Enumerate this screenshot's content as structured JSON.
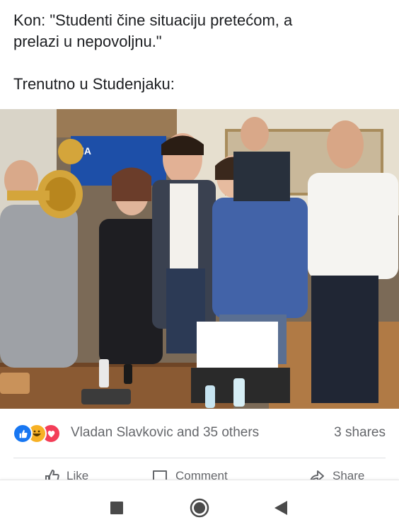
{
  "post": {
    "line1": "Kon: \"Studenti čine situaciju pretećom, a",
    "line2": "prelazi u nepovoljnu.\"",
    "line3": "Trenutno u Studenjaku:"
  },
  "photo": {
    "alt": ""
  },
  "reactions": {
    "icons": [
      "like-icon",
      "haha-icon",
      "love-icon"
    ],
    "summary": "Vladan Slavkovic and 35 others",
    "shares": "3 shares"
  },
  "actions": {
    "like_label": "Like",
    "comment_label": "Comment",
    "share_label": "Share"
  },
  "navbar": {
    "icons": [
      "recent-apps-icon",
      "home-icon",
      "back-icon"
    ]
  },
  "colors": {
    "accent": "#1877f2",
    "text": "#1c1e21",
    "muted": "#65676b"
  }
}
